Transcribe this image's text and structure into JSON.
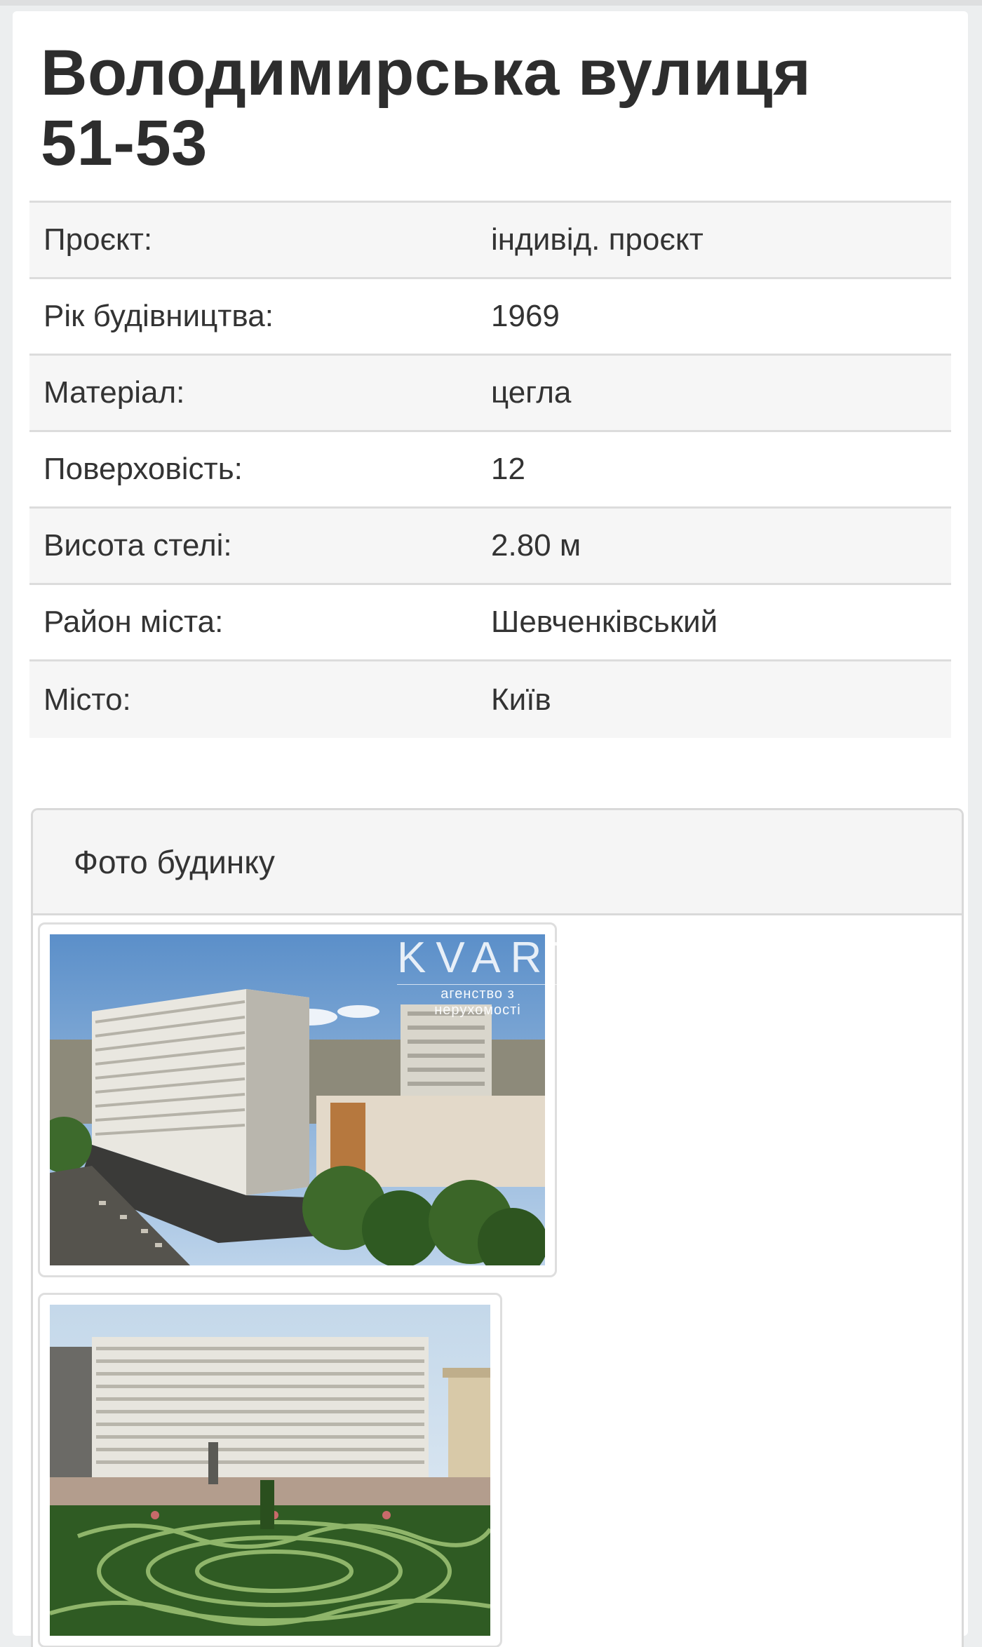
{
  "building": {
    "title": "Володимирська вулиця 51-53"
  },
  "properties": [
    {
      "label": "Проєкт:",
      "value": "індивід. проєкт"
    },
    {
      "label": "Рік будівництва:",
      "value": "1969"
    },
    {
      "label": "Матеріал:",
      "value": "цегла"
    },
    {
      "label": "Поверховість:",
      "value": "12"
    },
    {
      "label": "Висота стелі:",
      "value": "2.80 м"
    },
    {
      "label": "Район міста:",
      "value": "Шевченківський"
    },
    {
      "label": "Місто:",
      "value": "Київ"
    }
  ],
  "photos_panel": {
    "heading": "Фото будинку",
    "photos": [
      {
        "icon": "building-photo-aerial"
      },
      {
        "icon": "building-photo-square"
      }
    ]
  },
  "watermark": {
    "logo": "KVARTAL",
    "subtitle": "агенство з нерухомості"
  },
  "colors": {
    "page_bg": "#eceeef",
    "card_bg": "#ffffff",
    "row_stripe": "#f6f6f6",
    "divider": "#dcdcdc",
    "panel_header_bg": "#f5f5f5"
  }
}
